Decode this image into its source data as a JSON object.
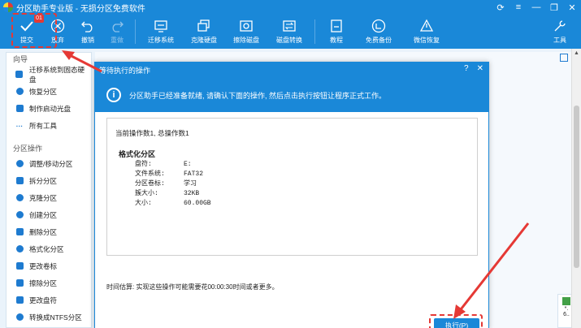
{
  "app": {
    "title": "分区助手专业版 - 无损分区免费软件"
  },
  "toolbar": {
    "badge": "01",
    "items": [
      {
        "label": "提交",
        "icon": "check-icon",
        "enabled": true
      },
      {
        "label": "放弃",
        "icon": "cancel-circle-icon",
        "enabled": true
      },
      {
        "label": "撤销",
        "icon": "undo-icon",
        "enabled": true
      },
      {
        "label": "重做",
        "icon": "redo-icon",
        "enabled": false
      },
      {
        "label": "迁移系统",
        "icon": "migrate-os-icon",
        "enabled": true
      },
      {
        "label": "克隆硬盘",
        "icon": "clone-disk-icon",
        "enabled": true
      },
      {
        "label": "擦除磁盘",
        "icon": "wipe-disk-icon",
        "enabled": true
      },
      {
        "label": "磁盘转换",
        "icon": "convert-disk-icon",
        "enabled": true
      },
      {
        "label": "教程",
        "icon": "tutorial-icon",
        "enabled": true
      },
      {
        "label": "免费备份",
        "icon": "backup-icon",
        "enabled": true
      },
      {
        "label": "微信恢复",
        "icon": "wechat-recovery-icon",
        "enabled": true
      },
      {
        "label": "工具",
        "icon": "tools-icon",
        "enabled": true
      }
    ]
  },
  "sidebar": {
    "wizard_title": "向导",
    "wizard_items": [
      {
        "label": "迁移系统到固态硬盘",
        "icon": "migrate-icon"
      },
      {
        "label": "恢复分区",
        "icon": "recover-icon"
      },
      {
        "label": "制作启动光盘",
        "icon": "boot-disc-icon"
      },
      {
        "label": "所有工具",
        "icon": "more-icon"
      }
    ],
    "partition_title": "分区操作",
    "partition_items": [
      {
        "label": "调整/移动分区",
        "icon": "resize-icon"
      },
      {
        "label": "拆分分区",
        "icon": "split-icon"
      },
      {
        "label": "克隆分区",
        "icon": "clone-icon"
      },
      {
        "label": "创建分区",
        "icon": "create-icon"
      },
      {
        "label": "删除分区",
        "icon": "delete-icon"
      },
      {
        "label": "格式化分区",
        "icon": "format-icon"
      },
      {
        "label": "更改卷标",
        "icon": "label-icon"
      },
      {
        "label": "擦除分区",
        "icon": "wipe-icon"
      },
      {
        "label": "更改盘符",
        "icon": "letter-icon"
      },
      {
        "label": "转换成NTFS分区",
        "icon": "ntfs-icon"
      }
    ]
  },
  "dialog": {
    "title": "等待执行的操作",
    "help": "?",
    "close": "✕",
    "info_text": "分区助手已经准备就绪, 请确认下面的操作, 然后点击执行按钮让程序正式工作。",
    "ops_count": "当前操作数1, 总操作数1",
    "op_title": "格式化分区",
    "details": [
      {
        "key": "盘符:",
        "value": "E:"
      },
      {
        "key": "文件系统:",
        "value": "FAT32"
      },
      {
        "key": "分区卷标:",
        "value": "学习"
      },
      {
        "key": "簇大小:",
        "value": "32KB"
      },
      {
        "key": "大小:",
        "value": "60.00GB"
      }
    ],
    "estimate": "时间估算: 实现这些操作可能需要花00:00:30时间或者更多。",
    "execute_label": "执行(P)"
  },
  "mini_panel": {
    "l1": "*.",
    "l2": "6.."
  },
  "colors": {
    "accent": "#1a88d8",
    "highlight": "#e53935"
  }
}
